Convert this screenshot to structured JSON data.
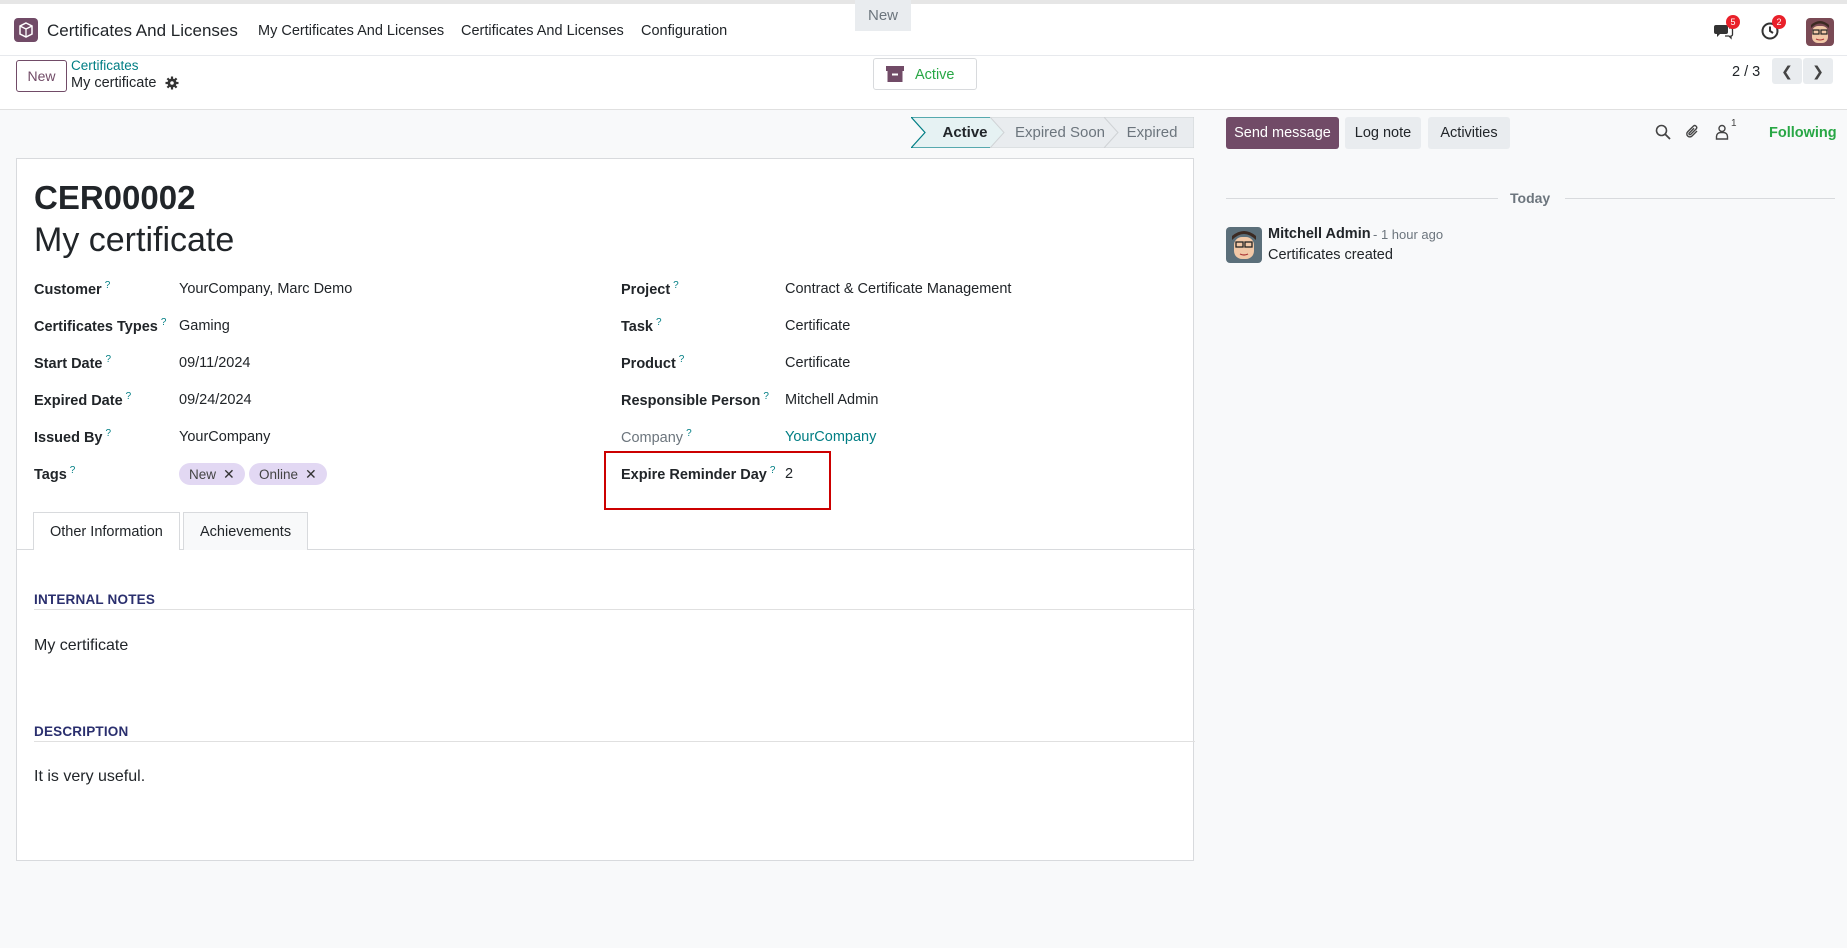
{
  "navbar": {
    "app_title": "Certificates And Licenses",
    "menu": [
      "My Certificates And Licenses",
      "Certificates And Licenses",
      "Configuration"
    ],
    "messages_badge": "5",
    "activities_badge": "2"
  },
  "control": {
    "new_label": "New",
    "breadcrumb_parent": "Certificates",
    "breadcrumb_current": "My certificate",
    "active_label": "Active",
    "pager": "2 / 3"
  },
  "statusbar": {
    "stages": [
      "New",
      "Active",
      "Expired Soon",
      "Expired"
    ],
    "current": "Active"
  },
  "record": {
    "reference": "CER00002",
    "name": "My certificate",
    "left_fields": [
      {
        "label": "Customer",
        "value": "YourCompany, Marc Demo"
      },
      {
        "label": "Certificates Types",
        "value": "Gaming"
      },
      {
        "label": "Start Date",
        "value": "09/11/2024"
      },
      {
        "label": "Expired Date",
        "value": "09/24/2024"
      },
      {
        "label": "Issued By",
        "value": "YourCompany"
      },
      {
        "label": "Tags",
        "value": ""
      }
    ],
    "tags": [
      "New",
      "Online"
    ],
    "right_fields": [
      {
        "label": "Project",
        "value": "Contract & Certificate Management"
      },
      {
        "label": "Task",
        "value": "Certificate"
      },
      {
        "label": "Product",
        "value": "Certificate"
      },
      {
        "label": "Responsible Person",
        "value": "Mitchell Admin"
      },
      {
        "label": "Company",
        "value": "YourCompany"
      },
      {
        "label": "Expire Reminder Day",
        "value": "2"
      }
    ],
    "help_mark": "?"
  },
  "tabs": [
    "Other Information",
    "Achievements"
  ],
  "sections": {
    "notes_title": "INTERNAL NOTES",
    "notes_text": "My certificate",
    "desc_title": "DESCRIPTION",
    "desc_text": "It is very useful."
  },
  "chatter": {
    "send_message": "Send message",
    "log_note": "Log note",
    "activities": "Activities",
    "followers_count": "1",
    "following": "Following",
    "day_separator": "Today",
    "author": "Mitchell Admin",
    "time": "- 1 hour ago",
    "body": "Certificates created"
  },
  "colors": {
    "brand": "#714b67",
    "link": "#017e84",
    "success": "#28a745",
    "highlight": "#cc0000"
  }
}
